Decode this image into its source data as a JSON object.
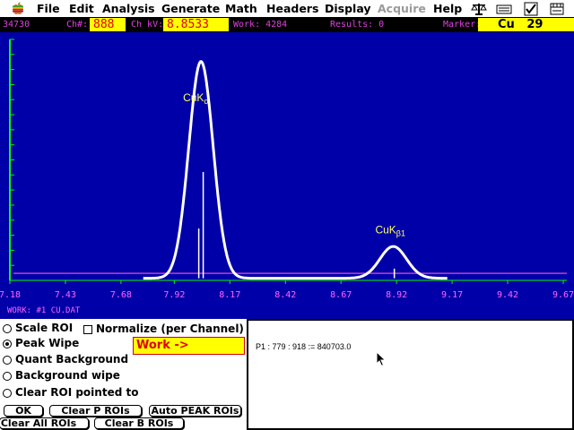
{
  "menubar": {
    "items": [
      "File",
      "Edit",
      "Analysis",
      "Generate",
      "Math",
      "Headers",
      "Display",
      "Acquire",
      "Help"
    ],
    "disabled": [
      "Acquire"
    ],
    "icons": [
      "apple-icon",
      "balance-icon",
      "keyboard-icon",
      "checkbox-icon",
      "ruler-icon"
    ]
  },
  "status": {
    "counts": "34730",
    "channel_label": "Ch#:",
    "channel_value": "888",
    "kv_label": "Ch kV:",
    "kv_value": "8.8533",
    "work_label": "Work: 4284",
    "results_label": "Results: 0",
    "marker_label": "Marker:",
    "marker_element": "Cu",
    "marker_number": "29"
  },
  "plot": {
    "background": "#0000a8",
    "spectrum_color": "#ffffff",
    "baseline_color": "#c040c0",
    "axis_color": "#00ff00",
    "label_color": "#ffff66",
    "tick_label_color": "#ff66ff",
    "file_label": "WORK: #1  CU.DAT",
    "x_ticks": [
      "7.18",
      "7.43",
      "7.68",
      "7.92",
      "8.17",
      "8.42",
      "8.67",
      "8.92",
      "9.17",
      "9.42",
      "9.67"
    ],
    "peak_labels": [
      {
        "base": "CuK",
        "sub": "α"
      },
      {
        "base": "CuK",
        "sub": "β1"
      }
    ]
  },
  "chart_data": {
    "type": "line",
    "x_unit": "kV",
    "xlim": [
      7.18,
      9.67
    ],
    "x_ticks": [
      7.18,
      7.43,
      7.68,
      7.92,
      8.17,
      8.42,
      8.67,
      8.92,
      9.17,
      9.42,
      9.67
    ],
    "y_max_counts": 34730,
    "baseline_level": 0.03,
    "peaks": [
      {
        "label": "CuKα",
        "center_kv": 8.04,
        "relative_height": 0.92,
        "width_kv": 0.055
      },
      {
        "label": "CuKβ1",
        "center_kv": 8.905,
        "relative_height": 0.135,
        "width_kv": 0.06
      }
    ],
    "marker_lines": [
      {
        "kv": 8.03,
        "relative_height": 0.22
      },
      {
        "kv": 8.05,
        "relative_height": 0.46
      },
      {
        "kv": 8.91,
        "relative_height": 0.05
      }
    ],
    "y_ticks_count": 16
  },
  "controls": {
    "radios": [
      {
        "label": "Scale ROI",
        "selected": false
      },
      {
        "label": "Peak Wipe",
        "selected": true
      },
      {
        "label": "Quant Background",
        "selected": false
      },
      {
        "label": "Background wipe",
        "selected": false
      },
      {
        "label": "Clear ROI pointed to",
        "selected": false
      }
    ],
    "normalize_label": "Normalize (per Channel)",
    "work_field": "Work  ->",
    "buttons": {
      "ok": "OK",
      "clear_p": "Clear P ROIs",
      "auto_peak": "Auto PEAK ROIs",
      "clear_all": "Clear All ROIs",
      "clear_b": "Clear B ROIs"
    }
  },
  "results": {
    "line": "P1 : 779 : 918 := 840703.0"
  }
}
